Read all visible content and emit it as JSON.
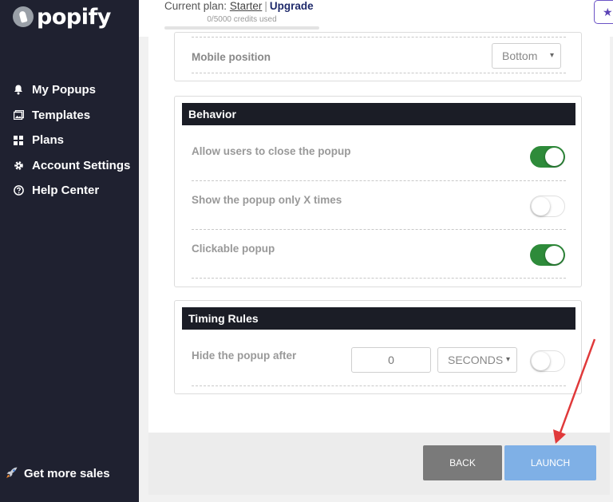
{
  "brand": {
    "name": "popify"
  },
  "sidebar": {
    "items": [
      {
        "label": "My Popups",
        "icon": "bell-icon"
      },
      {
        "label": "Templates",
        "icon": "templates-icon"
      },
      {
        "label": "Plans",
        "icon": "grid-icon"
      },
      {
        "label": "Account Settings",
        "icon": "gear-icon"
      },
      {
        "label": "Help Center",
        "icon": "help-icon"
      }
    ],
    "promo": {
      "label": "Get more sales",
      "icon": "rocket-icon"
    }
  },
  "header": {
    "plan_prefix": "Current plan:",
    "plan_name": "Starter",
    "separator": "|",
    "upgrade_label": "Upgrade",
    "credits_text": "0/5000 credits used",
    "credits_used": 0,
    "credits_total": 5000,
    "star_icon": "star-icon"
  },
  "position_section": {
    "mobile_position_label": "Mobile position",
    "mobile_position_value": "Bottom"
  },
  "behavior": {
    "title": "Behavior",
    "rows": [
      {
        "label": "Allow users to close the popup",
        "enabled": true
      },
      {
        "label": "Show the popup only X times",
        "enabled": false
      },
      {
        "label": "Clickable popup",
        "enabled": true
      }
    ]
  },
  "timing": {
    "title": "Timing Rules",
    "hide_label": "Hide the popup after",
    "hide_value": "0",
    "unit_value": "SECONDS",
    "enabled": false
  },
  "footer": {
    "back_label": "BACK",
    "launch_label": "LAUNCH"
  },
  "colors": {
    "sidebar_bg": "#1f2130",
    "toggle_on": "#2e8b3a",
    "launch_button": "#7fb0e6",
    "back_button": "#7a7a7a",
    "annotation_arrow": "#e0393a"
  }
}
